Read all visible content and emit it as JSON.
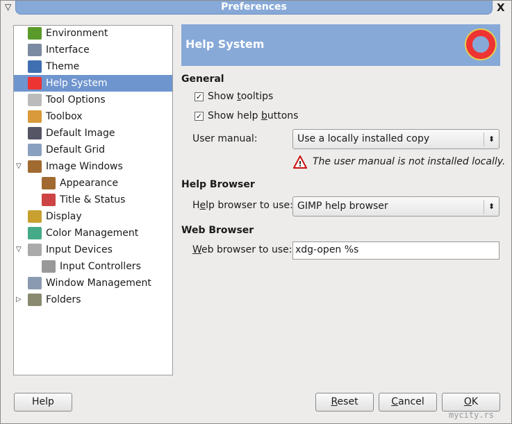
{
  "window": {
    "title": "Preferences",
    "menu_icon": "window-menu-icon",
    "close_label": "X"
  },
  "tree": [
    {
      "label": "Environment",
      "icon": "environment-icon",
      "color": "#5a9a2a",
      "level": 1
    },
    {
      "label": "Interface",
      "icon": "interface-icon",
      "color": "#7a8aa0",
      "level": 1
    },
    {
      "label": "Theme",
      "icon": "theme-icon",
      "color": "#3f6fb0",
      "level": 1
    },
    {
      "label": "Help System",
      "icon": "help-system-icon",
      "color": "#e33",
      "level": 1,
      "selected": true
    },
    {
      "label": "Tool Options",
      "icon": "tool-options-icon",
      "color": "#bbb",
      "level": 1
    },
    {
      "label": "Toolbox",
      "icon": "toolbox-icon",
      "color": "#d89a3a",
      "level": 1
    },
    {
      "label": "Default Image",
      "icon": "default-image-icon",
      "color": "#556",
      "level": 1
    },
    {
      "label": "Default Grid",
      "icon": "default-grid-icon",
      "color": "#8aa0c0",
      "level": 1
    },
    {
      "label": "Image Windows",
      "icon": "image-windows-icon",
      "color": "#a06a30",
      "level": 1,
      "expander": "expanded"
    },
    {
      "label": "Appearance",
      "icon": "appearance-icon",
      "color": "#a06a30",
      "level": 2
    },
    {
      "label": "Title & Status",
      "icon": "title-status-icon",
      "color": "#c44",
      "level": 2
    },
    {
      "label": "Display",
      "icon": "display-icon",
      "color": "#c8a030",
      "level": 1
    },
    {
      "label": "Color Management",
      "icon": "color-management-icon",
      "color": "#4a8",
      "level": 1
    },
    {
      "label": "Input Devices",
      "icon": "input-devices-icon",
      "color": "#aaa",
      "level": 1,
      "expander": "expanded"
    },
    {
      "label": "Input Controllers",
      "icon": "input-controllers-icon",
      "color": "#999",
      "level": 2
    },
    {
      "label": "Window Management",
      "icon": "window-management-icon",
      "color": "#8a9ab0",
      "level": 1
    },
    {
      "label": "Folders",
      "icon": "folders-icon",
      "color": "#8a8a70",
      "level": 1,
      "expander": "collapsed"
    }
  ],
  "header": {
    "title": "Help System",
    "icon": "lifebuoy-icon"
  },
  "general": {
    "title": "General",
    "show_tooltips": {
      "pre": "Show ",
      "u": "t",
      "post": "ooltips",
      "checked": true
    },
    "show_help_buttons": {
      "pre": "Show help ",
      "u": "b",
      "post": "uttons",
      "checked": true
    },
    "user_manual_label": "User manual:",
    "user_manual_value": "Use a locally installed copy",
    "warning": "The user manual is not installed locally."
  },
  "help_browser": {
    "title": "Help Browser",
    "label_pre": "H",
    "label_u": "e",
    "label_post": "lp browser to use:",
    "value": "GIMP help browser"
  },
  "web_browser": {
    "title": "Web Browser",
    "label_u": "W",
    "label_post": "eb browser to use:",
    "value": "xdg-open %s"
  },
  "buttons": {
    "help": "Help",
    "reset_u": "R",
    "reset": "eset",
    "cancel_u": "C",
    "cancel": "ancel",
    "ok_u": "O",
    "ok": "K"
  },
  "watermark": "mycity.rs"
}
